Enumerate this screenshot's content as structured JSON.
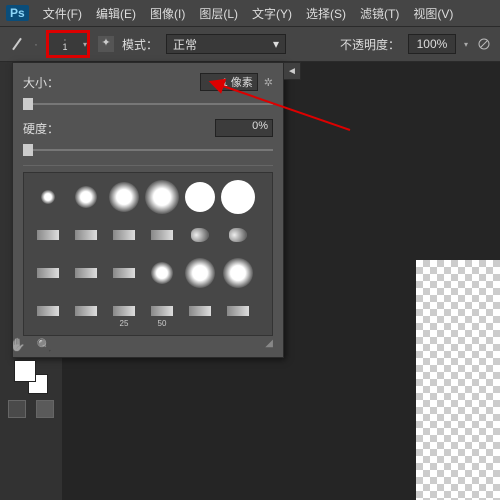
{
  "menu": {
    "file": "文件(F)",
    "edit": "编辑(E)",
    "image": "图像(I)",
    "layer": "图层(L)",
    "type": "文字(Y)",
    "select": "选择(S)",
    "filter": "滤镜(T)",
    "view": "视图(V)"
  },
  "options": {
    "brush_size_preview": "1",
    "mode_label": "模式：",
    "mode_value": "正常",
    "opacity_label": "不透明度：",
    "opacity_value": "100%"
  },
  "brush_panel": {
    "size_label": "大小：",
    "size_value": "1 像素",
    "hardness_label": "硬度：",
    "hardness_value": "0%",
    "preset_numbers": {
      "n25": "25",
      "n50": "50"
    }
  },
  "logo": "Ps"
}
